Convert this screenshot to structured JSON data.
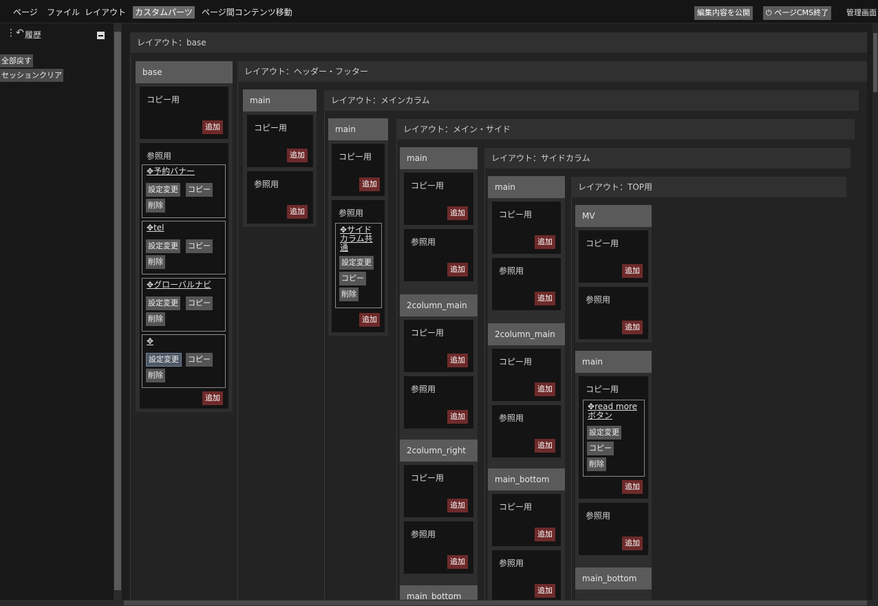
{
  "menu": {
    "page": "ページ",
    "file": "ファイル",
    "layout": "レイアウト",
    "custom_parts": "カスタムパーツ",
    "move_content": "ページ間コンテンツ移動",
    "publish": "編集内容を公開",
    "cms_exit": "ページCMS終了",
    "admin": "管理画面"
  },
  "sidebar": {
    "history": "履歴",
    "revert_all": "全部戻す",
    "session_clear": "セッションクリア"
  },
  "common": {
    "copy": "コピー用",
    "ref": "参照用",
    "add": "追加",
    "settings": "設定変更",
    "copy_btn": "コピー",
    "delete": "削除",
    "move": "✥"
  },
  "layouts": {
    "base": "レイアウト：base",
    "header_footer": "レイアウト：ヘッダー・フッター",
    "main_column": "レイアウト：メインカラム",
    "main_side": "レイアウト：メイン・サイド",
    "side_column": "レイアウト：サイドカラム",
    "top": "レイアウト：TOP用"
  },
  "columns": {
    "base": "base",
    "main": "main",
    "col2_main": "2column_main",
    "col2_right": "2column_right",
    "main_bottom": "main_bottom",
    "mv": "MV"
  },
  "parts": {
    "reserve_banner": "予約バナー",
    "tel": "tel",
    "global_nav": "グローバルナビ",
    "side_common": "サイドカラム共通",
    "read_more": "read moreボタン"
  }
}
